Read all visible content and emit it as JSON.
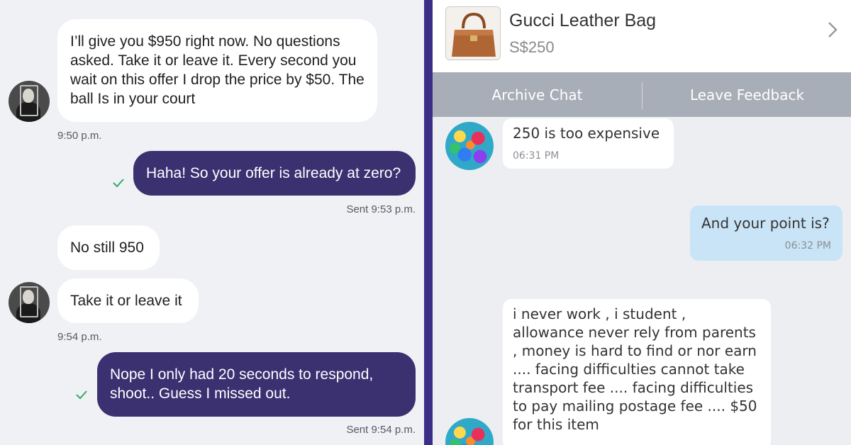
{
  "left_chat": {
    "messages": [
      {
        "text": "I’ll give you $950 right now. No questions asked. Take it or leave it. Every second you wait on this offer I drop the price by $50. The ball Is in your court",
        "time": "9:50 p.m."
      },
      {
        "text": "Haha! So your offer is already at zero?",
        "status": "Sent 9:53 p.m."
      },
      {
        "text": "No still 950"
      },
      {
        "text": "Take it or leave it",
        "time": "9:54 p.m."
      },
      {
        "text": "Nope I only had 20 seconds to respond, shoot.. Guess I missed out.",
        "status": "Sent 9:54 p.m."
      }
    ],
    "icons": {
      "avatar": "user-photo-avatar",
      "check": "check-icon"
    },
    "colors": {
      "background": "#f0f1f4",
      "outgoing": "#3b3171",
      "incoming": "#ffffff",
      "check": "#3aa66a"
    }
  },
  "right_chat": {
    "listing": {
      "title": "Gucci Leather Bag",
      "price": "S$250"
    },
    "actions": {
      "archive": "Archive Chat",
      "feedback": "Leave Feedback"
    },
    "messages": [
      {
        "text": "250 is too expensive",
        "time": "06:31 PM"
      },
      {
        "text": "And your point is?",
        "time": "06:32 PM"
      },
      {
        "text": "i never work , i student , allowance never rely from parents , money is hard to find or nor earn .... facing difficulties cannot take transport fee .... facing difficulties to pay mailing postage fee .... $50 for this item"
      }
    ],
    "icons": {
      "thumbnail": "handbag-thumbnail",
      "chevron": "chevron-right-icon",
      "avatar": "rainbow-rose-avatar"
    },
    "colors": {
      "background": "#eceef2",
      "action_bar": "#a8aeb7",
      "outgoing": "#c9e4f6"
    }
  },
  "divider_color": "#3b2e86"
}
